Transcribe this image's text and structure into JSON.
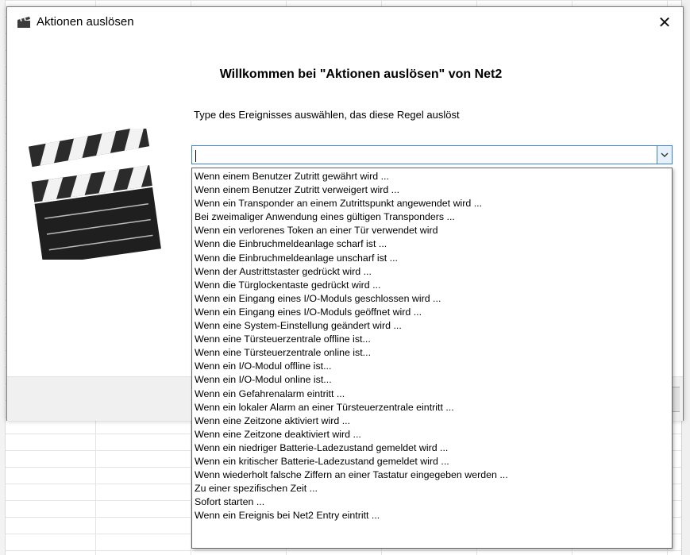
{
  "window": {
    "title": "Aktionen auslösen",
    "close_label": "✕"
  },
  "main": {
    "welcome": "Willkommen bei \"Aktionen auslösen\" von Net2",
    "prompt": "Type des Ereignisses auswählen, das diese Regel auslöst"
  },
  "combobox": {
    "value": ""
  },
  "dropdown": {
    "selected_index": 27,
    "options": [
      "Wenn einem Benutzer Zutritt gewährt wird ...",
      "Wenn einem Benutzer Zutritt verweigert wird ...",
      "Wenn ein Transponder an einem Zutrittspunkt angewendet wird ...",
      "Bei zweimaliger Anwendung eines gültigen Transponders ...",
      "Wenn ein verlorenes Token an einer Tür verwendet wird",
      "Wenn die Einbruchmeldeanlage scharf ist ...",
      "Wenn die Einbruchmeldeanlage unscharf ist ...",
      "Wenn der Austrittstaster gedrückt wird ...",
      "Wenn die Türglockentaste gedrückt wird ...",
      "Wenn ein Eingang eines I/O-Moduls geschlossen wird ...",
      "Wenn ein Eingang eines I/O-Moduls geöffnet wird ...",
      "Wenn eine System-Einstellung geändert wird ...",
      "Wenn eine Türsteuerzentrale offline ist...",
      "Wenn eine Türsteuerzentrale online ist...",
      "Wenn ein I/O-Modul offline ist...",
      "Wenn ein I/O-Modul online ist...",
      "Wenn ein Gefahrenalarm eintritt ...",
      "Wenn ein lokaler Alarm an einer Türsteuerzentrale eintritt ...",
      "Wenn eine Zeitzone aktiviert wird ...",
      "Wenn eine Zeitzone deaktiviert wird ...",
      "Wenn ein niedriger Batterie-Ladezustand gemeldet wird ...",
      "Wenn ein kritischer Batterie-Ladezustand gemeldet wird ...",
      "Wenn wiederholt falsche Ziffern an einer Tastatur eingegeben werden ...",
      "Zu einer spezifischen Zeit ...",
      "Sofort starten ...",
      "Wenn ein Ereignis bei Net2 Entry eintritt ..."
    ]
  },
  "icons": {
    "title_icon": "clapperboard-icon",
    "illustration": "clapperboard-icon",
    "dropdown_arrow": "chevron-down-icon",
    "close": "close-icon"
  },
  "colors": {
    "selection": "#0078d7",
    "focus_border": "#3b7fd6"
  }
}
